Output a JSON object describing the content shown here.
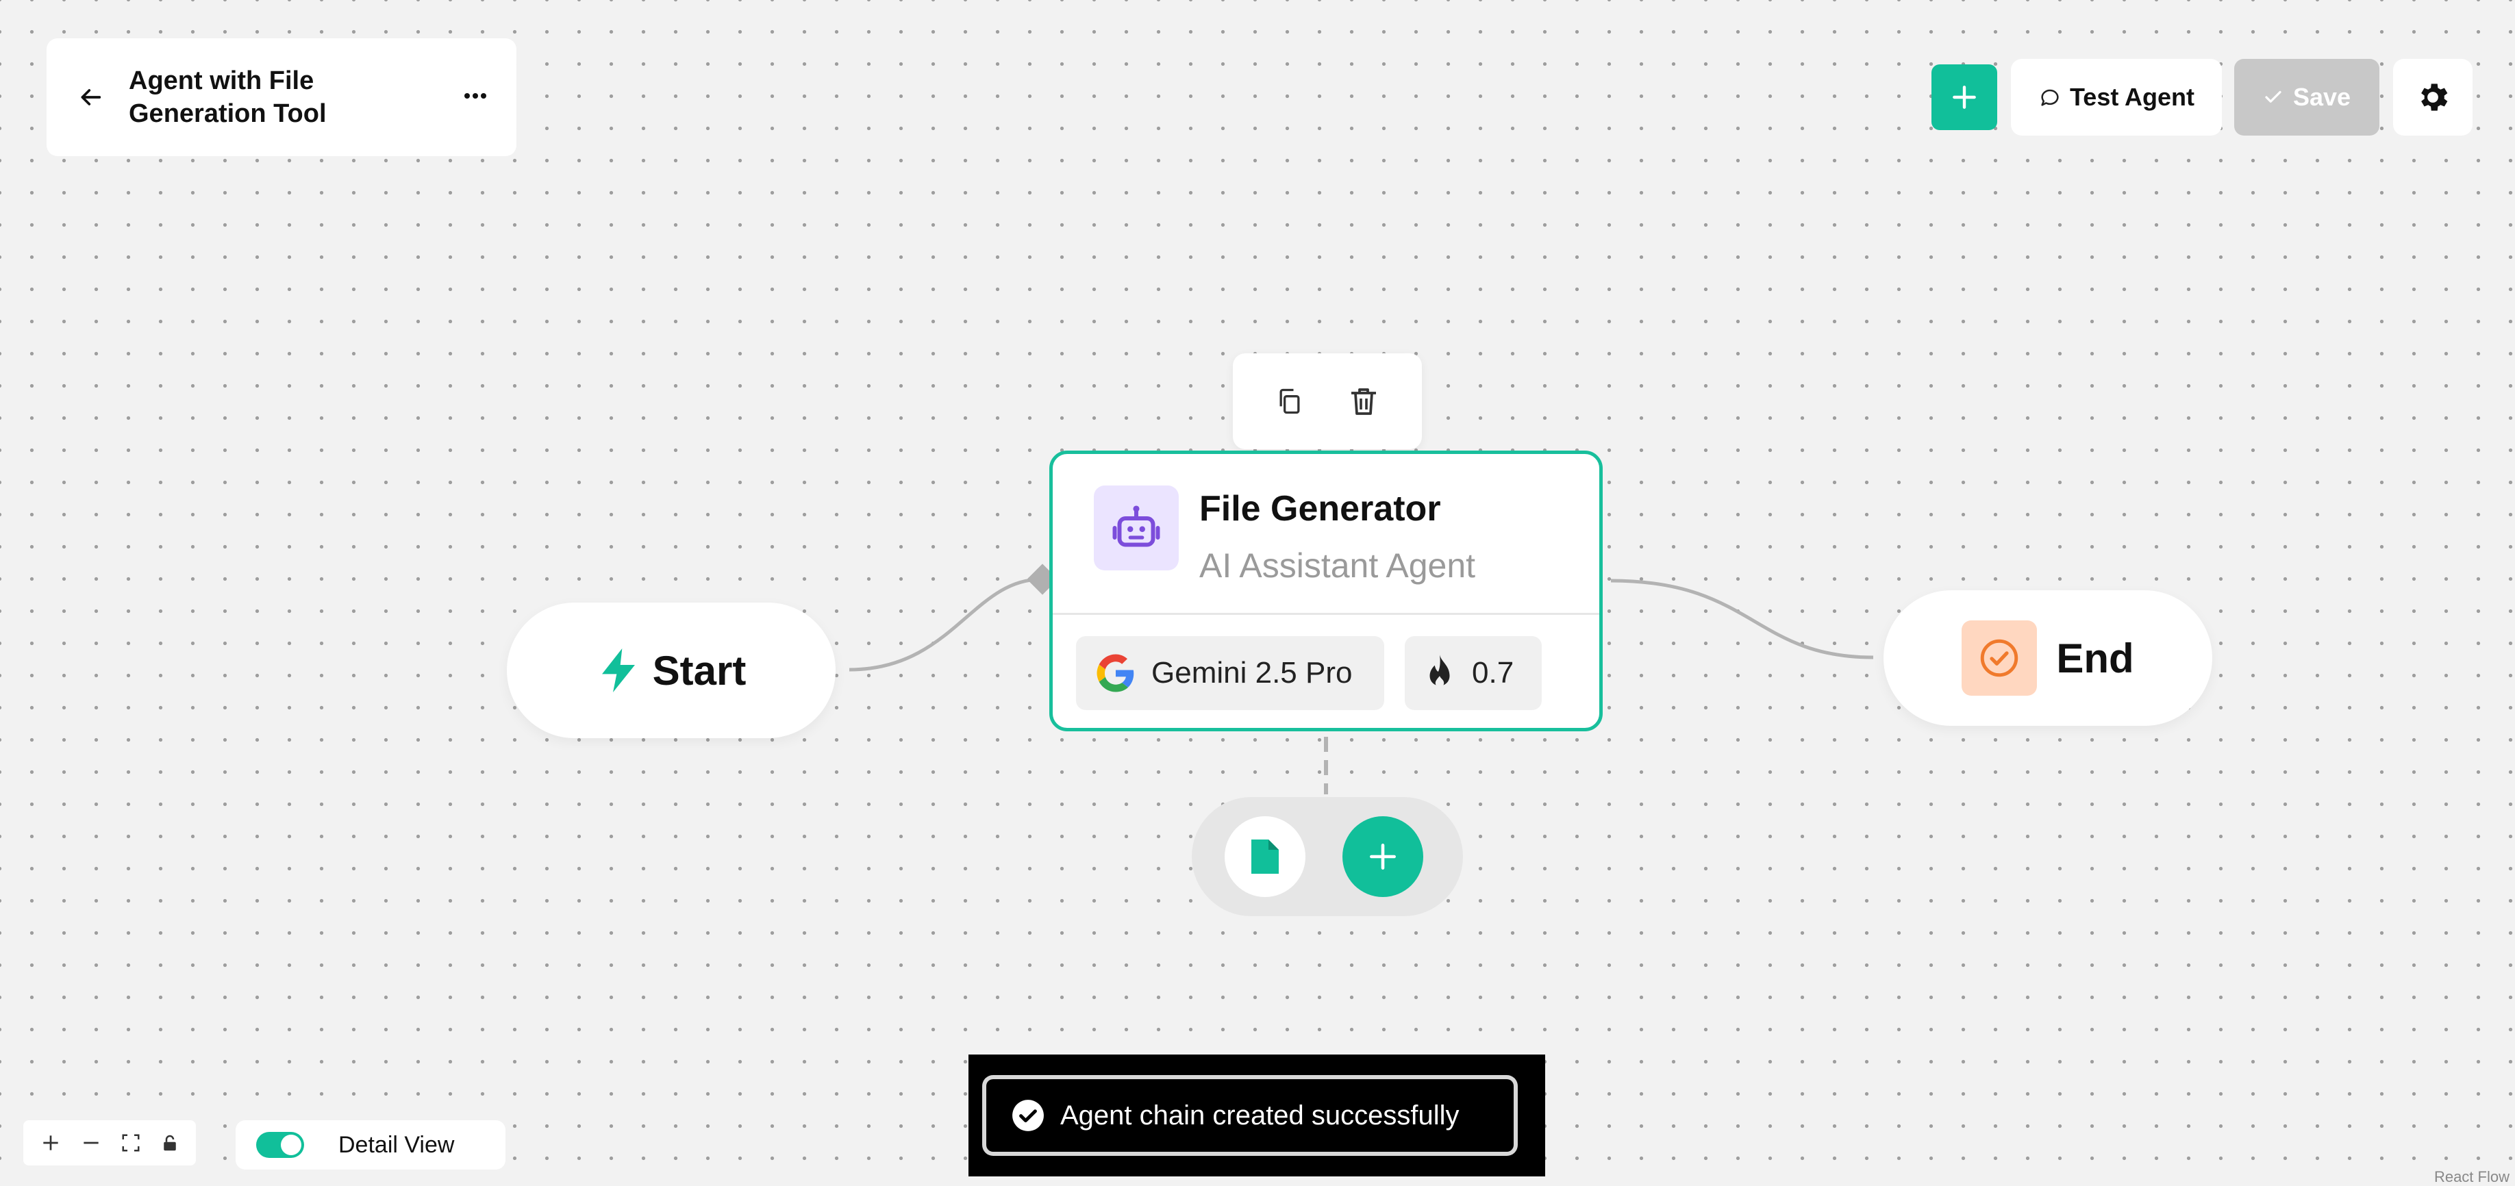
{
  "header": {
    "title": "Agent with File Generation Tool",
    "back_icon": "arrow-left-icon",
    "more_icon": "more-horizontal-icon"
  },
  "actions": {
    "add_icon": "plus-icon",
    "test_label": "Test Agent",
    "test_icon": "chat-bubble-icon",
    "save_label": "Save",
    "save_icon": "check-icon",
    "settings_icon": "gear-icon"
  },
  "nodes": {
    "start": {
      "label": "Start",
      "icon": "lightning-icon"
    },
    "agent": {
      "title": "File Generator",
      "subtitle": "AI Assistant Agent",
      "icon": "robot-icon",
      "model": "Gemini 2.5 Pro",
      "model_icon": "google-icon",
      "temperature": "0.7",
      "temperature_icon": "flame-icon"
    },
    "end": {
      "label": "End",
      "icon": "check-circle-icon"
    },
    "toolbar": {
      "copy_icon": "copy-icon",
      "delete_icon": "trash-icon"
    },
    "tools": {
      "file_icon": "file-icon",
      "add_icon": "plus-icon"
    }
  },
  "canvas_controls": {
    "zoom_in_icon": "plus-icon",
    "zoom_out_icon": "minus-icon",
    "fit_icon": "fit-view-icon",
    "lock_icon": "lock-icon",
    "detail_view_label": "Detail View",
    "detail_view_on": true
  },
  "toast": {
    "message": "Agent chain created successfully",
    "icon": "check-circle-icon"
  },
  "attribution": "React Flow",
  "colors": {
    "accent": "#11bf9a",
    "save_disabled": "#c8c8c8",
    "end_icon_bg": "#ffd7c0",
    "agent_icon_bg": "#ebe4ff"
  }
}
